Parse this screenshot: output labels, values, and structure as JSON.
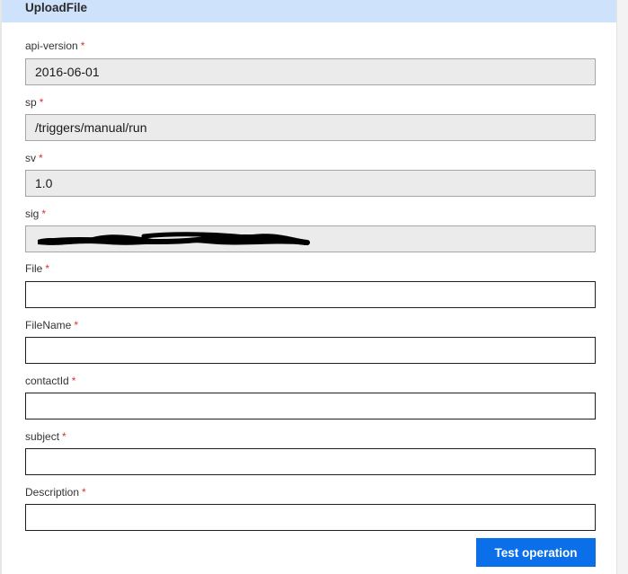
{
  "header": {
    "title": "UploadFile"
  },
  "required_mark": "*",
  "fields": [
    {
      "label": "api-version",
      "value": "2016-06-01"
    },
    {
      "label": "sp",
      "value": "/triggers/manual/run"
    },
    {
      "label": "sv",
      "value": "1.0"
    },
    {
      "label": "sig",
      "value": "",
      "redacted": true
    },
    {
      "label": "File",
      "value": ""
    },
    {
      "label": "FileName",
      "value": ""
    },
    {
      "label": "contactId",
      "value": ""
    },
    {
      "label": "subject",
      "value": ""
    },
    {
      "label": "Description",
      "value": ""
    }
  ],
  "actions": {
    "test_label": "Test operation"
  },
  "colors": {
    "header_bg": "#cfe2fb",
    "required": "#d13438",
    "button_bg": "#0a6fe8",
    "disabled_field_bg": "#ebebeb"
  }
}
